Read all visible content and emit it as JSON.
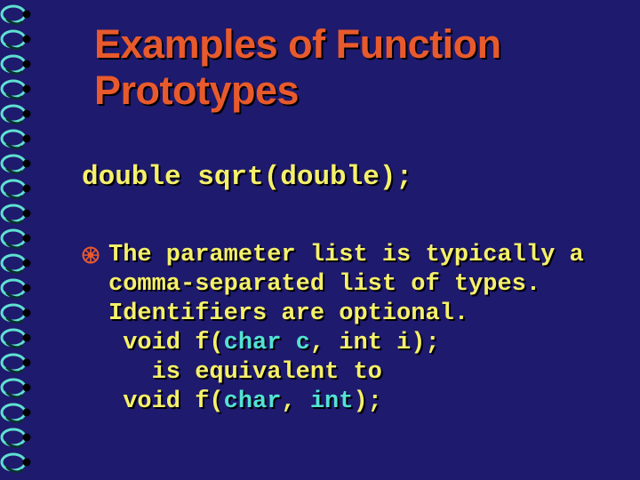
{
  "title": "Examples of Function Prototypes",
  "code_line": "double sqrt(double);",
  "body": {
    "l1": "The parameter list is typically a",
    "l2": "comma-separated list of types.",
    "l3": "Identifiers are optional.",
    "l4a": " void f(",
    "l4b": "char c",
    "l4c": ", int i);",
    "l5": "   is equivalent to",
    "l6a": " void f(",
    "l6b": "char",
    "l6c": ", ",
    "l6d": "int",
    "l6e": ");"
  }
}
